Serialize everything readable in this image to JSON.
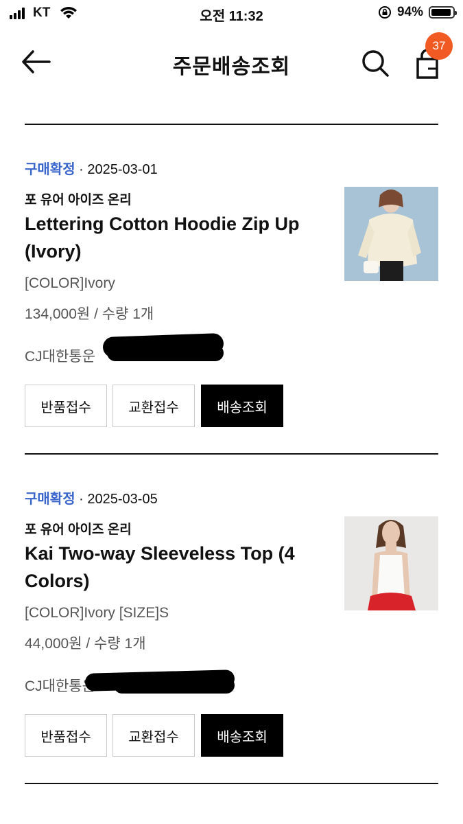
{
  "status_bar": {
    "carrier": "KT",
    "time": "오전 11:32",
    "battery": "94%",
    "battery_level": 0.94,
    "icons": [
      "signal-icon",
      "wifi-icon",
      "orientation-lock-icon",
      "battery-icon"
    ]
  },
  "header": {
    "title": "주문배송조회",
    "cart_count": "37",
    "icons": [
      "back-arrow-icon",
      "search-icon",
      "cart-icon"
    ]
  },
  "orders": [
    {
      "status": "구매확정",
      "separator": "·",
      "date": "2025-03-01",
      "brand": "포 유어 아이즈 온리",
      "title": "Lettering Cotton Hoodie Zip Up (Ivory)",
      "option": "[COLOR]Ivory",
      "price": "134,000원 / 수량 1개",
      "courier": "CJ대한통운",
      "buttons": [
        "반품접수",
        "교환접수",
        "배송조회"
      ]
    },
    {
      "status": "구매확정",
      "separator": "·",
      "date": "2025-03-05",
      "brand": "포 유어 아이즈 온리",
      "title": "Kai Two-way Sleeveless Top (4 Colors)",
      "option": "[COLOR]Ivory [SIZE]S",
      "price": "44,000원 / 수량 1개",
      "courier": "CJ대한통운",
      "buttons": [
        "반품접수",
        "교환접수",
        "배송조회"
      ]
    }
  ],
  "colors": {
    "status_blue": "#3a66cc",
    "badge_orange": "#f15a22",
    "button_dark": "#000000"
  }
}
